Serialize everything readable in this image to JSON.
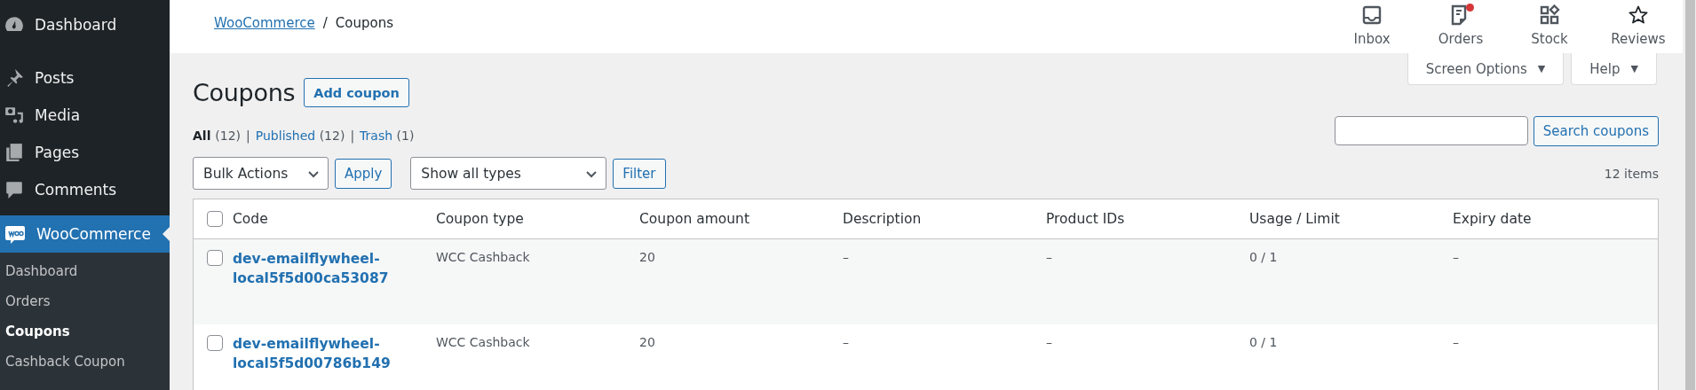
{
  "sidebar": {
    "items": [
      {
        "label": "Dashboard",
        "kind": "gauge",
        "selected": false
      },
      {
        "label": "Posts",
        "kind": "pin",
        "selected": false
      },
      {
        "label": "Media",
        "kind": "media",
        "selected": false
      },
      {
        "label": "Pages",
        "kind": "pages",
        "selected": false
      },
      {
        "label": "Comments",
        "kind": "comment",
        "selected": false
      },
      {
        "label": "WooCommerce",
        "kind": "woo",
        "selected": true
      }
    ],
    "submenu": [
      {
        "label": "Dashboard",
        "selected": false
      },
      {
        "label": "Orders",
        "selected": false
      },
      {
        "label": "Coupons",
        "selected": true
      },
      {
        "label": "Cashback Coupon",
        "selected": false
      }
    ]
  },
  "header": {
    "breadcrumb": [
      {
        "label": "WooCommerce",
        "kind": "link"
      },
      {
        "label": "Coupons",
        "kind": "current"
      }
    ],
    "separator": "/",
    "activity": [
      {
        "label": "Inbox",
        "kind": "inbox",
        "badge": false
      },
      {
        "label": "Orders",
        "kind": "orders",
        "badge": true
      },
      {
        "label": "Stock",
        "kind": "stock",
        "badge": false
      },
      {
        "label": "Reviews",
        "kind": "star",
        "badge": false
      }
    ]
  },
  "screen_tabs": [
    {
      "label": "Screen Options",
      "caret": "▼"
    },
    {
      "label": "Help",
      "caret": "▼"
    }
  ],
  "page": {
    "title": "Coupons",
    "add_button": "Add coupon"
  },
  "views": [
    {
      "label": "All",
      "count": "(12)",
      "selected": true
    },
    {
      "label": "Published",
      "count": "(12)",
      "selected": false
    },
    {
      "label": "Trash",
      "count": "(1)",
      "selected": false
    }
  ],
  "view_separator": "|",
  "search": {
    "button": "Search coupons"
  },
  "bulk": {
    "select": "Bulk Actions",
    "button": "Apply"
  },
  "type_filter": {
    "select": "Show all types",
    "button": "Filter"
  },
  "items_count": "12 items",
  "table": {
    "select_all_checked": false,
    "columns": [
      "Code",
      "Coupon type",
      "Coupon amount",
      "Description",
      "Product IDs",
      "Usage / Limit",
      "Expiry date"
    ],
    "rows": [
      {
        "checked": false,
        "cells": [
          "dev-emailflywheel-local5f5d00ca53087",
          "WCC Cashback",
          "20",
          "–",
          "–",
          "0 / 1",
          "–"
        ]
      },
      {
        "checked": false,
        "cells": [
          "dev-emailflywheel-local5f5d00786b149",
          "WCC Cashback",
          "20",
          "–",
          "–",
          "0 / 1",
          "–"
        ]
      }
    ]
  }
}
